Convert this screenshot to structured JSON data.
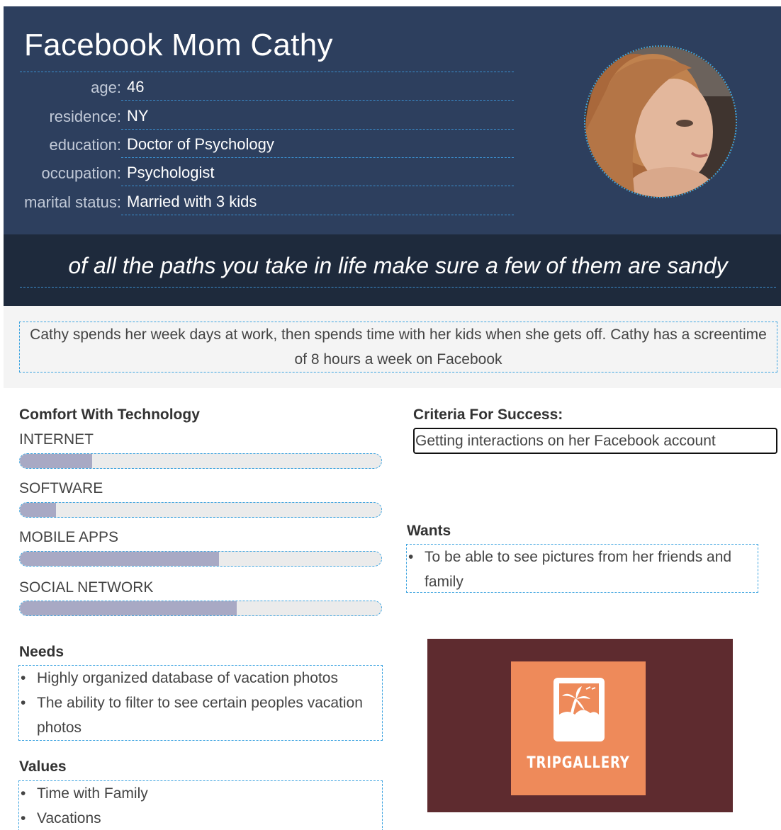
{
  "persona": {
    "name": "Facebook Mom Cathy",
    "attributes": [
      {
        "label": "age:",
        "value": "46"
      },
      {
        "label": "residence:",
        "value": "NY"
      },
      {
        "label": "education:",
        "value": "Doctor of Psychology"
      },
      {
        "label": "occupation:",
        "value": "Psychologist"
      },
      {
        "label": "marital status:",
        "value": "Married with 3 kids"
      }
    ],
    "quote": "of all the paths you take in life make sure a few of them are sandy",
    "summary": "Cathy spends her week days at work, then spends time with her kids when she gets off. Cathy has a screentime of 8 hours a week on Facebook"
  },
  "comfort": {
    "title": "Comfort With Technology",
    "items": [
      {
        "label": "INTERNET",
        "level": 0.2
      },
      {
        "label": "SOFTWARE",
        "level": 0.1
      },
      {
        "label": "MOBILE APPS",
        "level": 0.55
      },
      {
        "label": "SOCIAL NETWORK",
        "level": 0.6
      }
    ]
  },
  "criteria": {
    "title": "Criteria For Success:",
    "text": "Getting interactions on her Facebook account"
  },
  "wants": {
    "title": "Wants",
    "items": [
      "To be able to see pictures from her friends and family"
    ]
  },
  "needs": {
    "title": "Needs",
    "items": [
      "Highly organized database of vacation photos",
      "The ability to filter to see certain peoples vacation photos"
    ]
  },
  "values": {
    "title": "Values",
    "items": [
      "Time with Family",
      "Vacations"
    ]
  },
  "logo": {
    "text": "TRIPGALLERY",
    "icon": "photo-palm-icon"
  },
  "colors": {
    "header_bg": "#2d3f5e",
    "quote_bg": "#1e2a3c",
    "bar_fill": "#a8a9c4",
    "logo_panel": "#5e2b2f",
    "logo_square": "#ee8a5a",
    "dashed_accent": "#3ba3e0"
  }
}
